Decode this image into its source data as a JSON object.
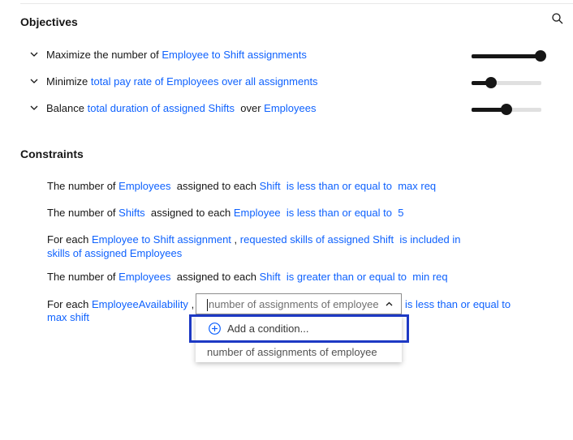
{
  "objectives": {
    "title": "Objectives",
    "items": [
      {
        "prefix": "Maximize the number of",
        "link": "Employee to Shift assignments",
        "middle": "",
        "link2": "",
        "weight": 1.0
      },
      {
        "prefix": "Minimize",
        "link": "total pay rate of Employees over all assignments",
        "middle": "",
        "link2": "",
        "weight": 0.28
      },
      {
        "prefix": "Balance",
        "link": "total duration of assigned Shifts",
        "middle": "over",
        "link2": "Employees",
        "weight": 0.5
      }
    ]
  },
  "constraints": {
    "title": "Constraints",
    "c1": {
      "t1": "The number of",
      "l1": "Employees",
      "t2": "assigned to each",
      "l2": "Shift",
      "l3": "is less than or equal to",
      "l4": "max req"
    },
    "c2": {
      "t1": "The number of",
      "l1": "Shifts",
      "t2": "assigned to each",
      "l2": "Employee",
      "l3": "is less than or equal to",
      "l4": "5"
    },
    "c3": {
      "t1": "For each",
      "l1": "Employee to Shift assignment",
      "t2": ",",
      "l2": "requested skills of assigned Shift",
      "l3": "is included in",
      "l4": "skills of assigned Employees"
    },
    "c4": {
      "t1": "The number of",
      "l1": "Employees",
      "t2": "assigned to each",
      "l2": "Shift",
      "l3": "is greater than or equal to",
      "l4": "min req"
    },
    "c5": {
      "t1": "For each",
      "l1": "EmployeeAvailability",
      "t2": ",",
      "l3": "is less than or equal to",
      "l4": "max shift"
    }
  },
  "combo": {
    "value": "number of assignments of employee"
  },
  "dropdown": {
    "add_condition": "Add a condition...",
    "option": "number of assignments of employee"
  },
  "colors": {
    "link": "#0f62fe",
    "highlight": "#1d39c4"
  },
  "icons": {
    "search": "search-icon",
    "chevron": "chevron-down-icon",
    "chevron_up": "chevron-up-icon",
    "add": "add-circle-icon"
  }
}
